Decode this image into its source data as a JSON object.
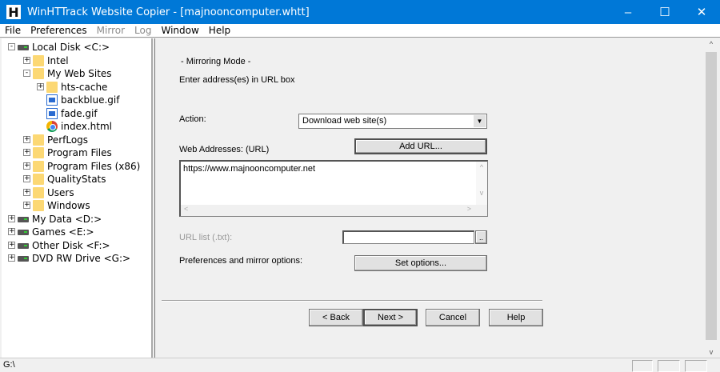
{
  "window": {
    "title": "WinHTTrack Website Copier - [majnooncomputer.whtt]",
    "icon_letter": "H",
    "minimize": "–",
    "maximize": "☐",
    "close": "✕"
  },
  "menu": [
    {
      "label": "File",
      "enabled": true
    },
    {
      "label": "Preferences",
      "enabled": true
    },
    {
      "label": "Mirror",
      "enabled": false
    },
    {
      "label": "Log",
      "enabled": false
    },
    {
      "label": "Window",
      "enabled": true
    },
    {
      "label": "Help",
      "enabled": true
    }
  ],
  "tree": [
    {
      "label": "Local Disk <C:>",
      "level": 0,
      "icon": "drive",
      "exp": "-"
    },
    {
      "label": "Intel",
      "level": 1,
      "icon": "folder",
      "exp": "+"
    },
    {
      "label": "My Web Sites",
      "level": 1,
      "icon": "folder",
      "exp": "-"
    },
    {
      "label": "hts-cache",
      "level": 2,
      "icon": "folder",
      "exp": "+"
    },
    {
      "label": "backblue.gif",
      "level": 2,
      "icon": "img",
      "exp": ""
    },
    {
      "label": "fade.gif",
      "level": 2,
      "icon": "img",
      "exp": ""
    },
    {
      "label": "index.html",
      "level": 2,
      "icon": "chrome",
      "exp": ""
    },
    {
      "label": "PerfLogs",
      "level": 1,
      "icon": "folder",
      "exp": "+"
    },
    {
      "label": "Program Files",
      "level": 1,
      "icon": "folder",
      "exp": "+"
    },
    {
      "label": "Program Files (x86)",
      "level": 1,
      "icon": "folder",
      "exp": "+"
    },
    {
      "label": "QualityStats",
      "level": 1,
      "icon": "folder",
      "exp": "+"
    },
    {
      "label": "Users",
      "level": 1,
      "icon": "folder",
      "exp": "+"
    },
    {
      "label": "Windows",
      "level": 1,
      "icon": "folder",
      "exp": "+"
    },
    {
      "label": "My Data <D:>",
      "level": 0,
      "icon": "drive",
      "exp": "+"
    },
    {
      "label": "Games <E:>",
      "level": 0,
      "icon": "drive",
      "exp": "+"
    },
    {
      "label": "Other Disk <F:>",
      "level": 0,
      "icon": "drive",
      "exp": "+"
    },
    {
      "label": "DVD RW Drive <G:>",
      "level": 0,
      "icon": "drive",
      "exp": "+"
    }
  ],
  "form": {
    "mode_title": "- Mirroring Mode -",
    "instruction": "Enter address(es) in URL box",
    "action_label": "Action:",
    "action_value": "Download web site(s)",
    "urls_label": "Web Addresses: (URL)",
    "add_url": "Add URL...",
    "urls_value": "https://www.majnooncomputer.net",
    "url_list_label": "URL list (.txt):",
    "url_list_value": "",
    "browse": "..",
    "prefs_label": "Preferences and mirror options:",
    "set_options": "Set options..."
  },
  "buttons": {
    "back": "< Back",
    "next": "Next >",
    "cancel": "Cancel",
    "help": "Help"
  },
  "status": {
    "text": "G:\\"
  }
}
